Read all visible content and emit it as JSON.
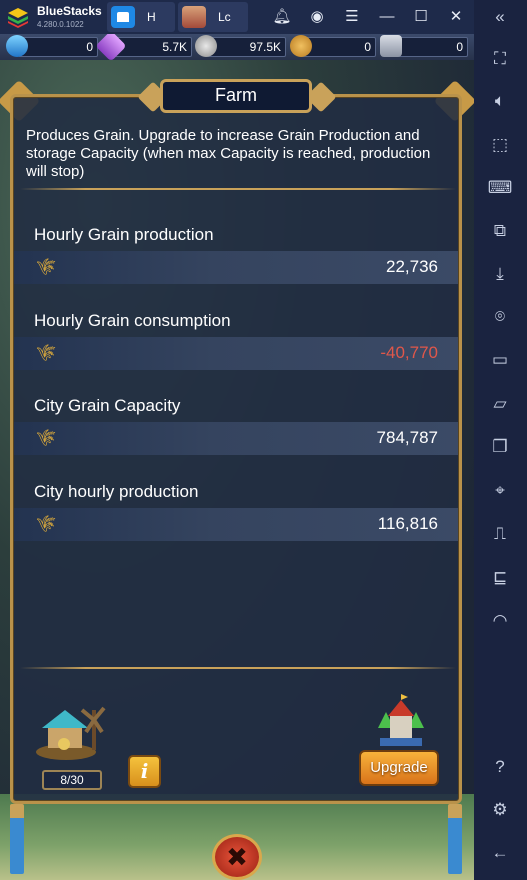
{
  "titlebar": {
    "app_name": "BlueStacks",
    "version": "4.280.0.1022",
    "tabs": [
      {
        "label": "H"
      },
      {
        "label": "Lc"
      }
    ],
    "controls": [
      "bell-icon",
      "user-icon",
      "menu-icon",
      "minimize-icon",
      "maximize-icon",
      "close-icon",
      "collapse-sidebar-icon"
    ]
  },
  "resources": [
    {
      "name": "gems",
      "value": "0"
    },
    {
      "name": "crystal",
      "value": "5.7K"
    },
    {
      "name": "silver",
      "value": "97.5K"
    },
    {
      "name": "badge",
      "value": "0"
    },
    {
      "name": "shield",
      "value": "0"
    }
  ],
  "panel": {
    "title": "Farm",
    "description": "Produces Grain. Upgrade to increase Grain Production and storage Capacity (when max Capacity is reached, production will stop)",
    "stats": [
      {
        "label": "Hourly Grain production",
        "value": "22,736",
        "negative": false
      },
      {
        "label": "Hourly Grain consumption",
        "value": "-40,770",
        "negative": true
      },
      {
        "label": "City Grain Capacity",
        "value": "784,787",
        "negative": false
      },
      {
        "label": "City hourly production",
        "value": "116,816",
        "negative": false
      }
    ],
    "level": "8/30",
    "info_label": "i",
    "upgrade_label": "Upgrade",
    "close_label": "✖"
  },
  "colors": {
    "accent_gold": "#c9a25a",
    "negative_value": "#e0574a",
    "upgrade_button": "#f0a030"
  }
}
